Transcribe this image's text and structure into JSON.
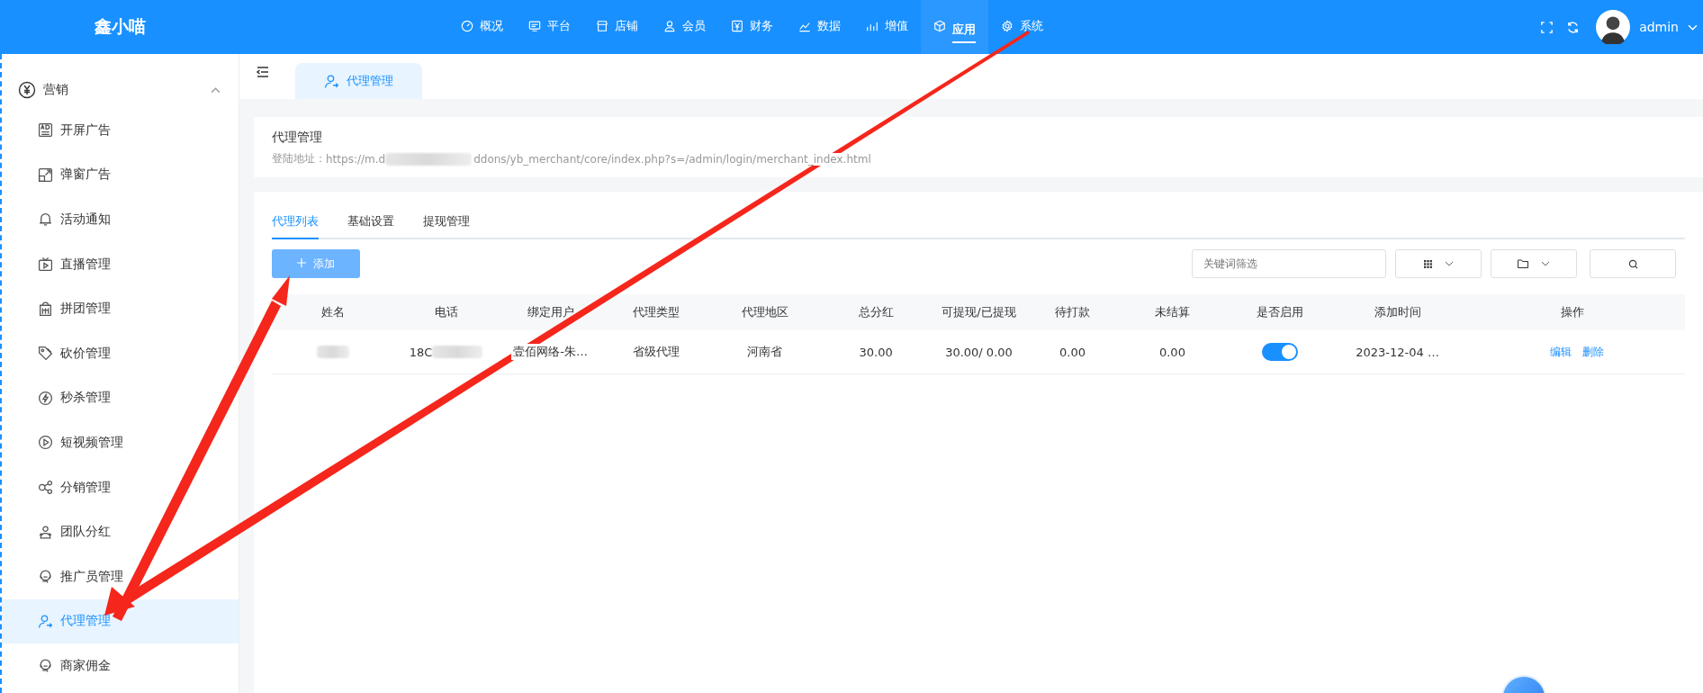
{
  "topbar": {
    "logo": "鑫小喵",
    "nav": [
      {
        "label": "概况",
        "selected": false
      },
      {
        "label": "平台",
        "selected": false
      },
      {
        "label": "店铺",
        "selected": false
      },
      {
        "label": "会员",
        "selected": false
      },
      {
        "label": "财务",
        "selected": false
      },
      {
        "label": "数据",
        "selected": false
      },
      {
        "label": "增值",
        "selected": false
      },
      {
        "label": "应用",
        "selected": true
      },
      {
        "label": "系统",
        "selected": false
      }
    ],
    "username": "admin"
  },
  "sidebar": {
    "group": {
      "label": "营销",
      "expanded": true
    },
    "items": [
      {
        "label": "开屏广告",
        "selected": false
      },
      {
        "label": "弹窗广告",
        "selected": false
      },
      {
        "label": "活动通知",
        "selected": false
      },
      {
        "label": "直播管理",
        "selected": false
      },
      {
        "label": "拼团管理",
        "selected": false
      },
      {
        "label": "砍价管理",
        "selected": false
      },
      {
        "label": "秒杀管理",
        "selected": false
      },
      {
        "label": "短视频管理",
        "selected": false
      },
      {
        "label": "分销管理",
        "selected": false
      },
      {
        "label": "团队分红",
        "selected": false
      },
      {
        "label": "推广员管理",
        "selected": false
      },
      {
        "label": "代理管理",
        "selected": true
      },
      {
        "label": "商家佣金",
        "selected": false
      }
    ]
  },
  "page_tabs": [
    {
      "label": "代理管理",
      "selected": true
    }
  ],
  "header": {
    "title": "代理管理",
    "url_label": "登陆地址：",
    "url_start": "https://m.d",
    "url_end": "ddons/yb_merchant/core/index.php?s=/admin/login/merchant_index.html"
  },
  "tabs": [
    {
      "label": "代理列表",
      "selected": true
    },
    {
      "label": "基础设置",
      "selected": false
    },
    {
      "label": "提现管理",
      "selected": false
    }
  ],
  "toolbar": {
    "add_button": "添加",
    "search": {
      "placeholder": "关键词筛选"
    }
  },
  "table": {
    "columns": [
      "姓名",
      "电话",
      "绑定用户",
      "代理类型",
      "代理地区",
      "总分红",
      "可提现/已提现",
      "待打款",
      "未结算",
      "是否启用",
      "添加时间",
      "操作"
    ],
    "rows": [
      {
        "phone": "18C",
        "user": "壹佰网络-朱…",
        "type": "省级代理",
        "region": "河南省",
        "total": "30.00",
        "withdraw": "30.00/ 0.00",
        "pending": "0.00",
        "unsettled": "0.00",
        "enabled": true,
        "time": "2023-12-04 …",
        "actions": [
          "编辑",
          "删除"
        ]
      }
    ]
  }
}
